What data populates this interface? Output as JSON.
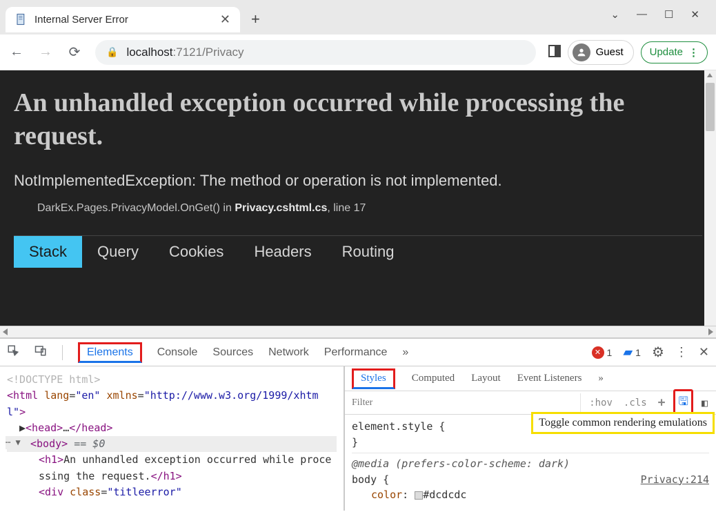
{
  "window": {
    "tab_title": "Internal Server Error"
  },
  "toolbar": {
    "url_host": "localhost",
    "url_port_path": ":7121/Privacy",
    "guest_label": "Guest",
    "update_label": "Update"
  },
  "error_page": {
    "heading": "An unhandled exception occurred while processing the request.",
    "exception_line": "NotImplementedException: The method or operation is not implemented.",
    "stack_prefix": "DarkEx.Pages.PrivacyModel.OnGet() in ",
    "stack_file": "Privacy.cshtml.cs",
    "stack_line_suffix": ", line 17",
    "tabs": [
      "Stack",
      "Query",
      "Cookies",
      "Headers",
      "Routing"
    ]
  },
  "devtools": {
    "tabs": [
      "Elements",
      "Console",
      "Sources",
      "Network",
      "Performance"
    ],
    "more": "»",
    "error_count": "1",
    "info_count": "1",
    "styles_tabs": [
      "Styles",
      "Computed",
      "Layout",
      "Event Listeners"
    ],
    "filter_placeholder": "Filter",
    "hov": ":hov",
    "cls": ".cls",
    "tooltip": "Toggle common rendering emulations",
    "dom": {
      "doctype": "<!DOCTYPE html>",
      "html_open": "<html lang=\"en\" xmlns=\"http://www.w3.org/1999/xhtml\">",
      "head": "<head>…</head>",
      "body_open": "<body>",
      "body_eq": " == $0",
      "h1_text": "An unhandled exception occurred while processing the request.",
      "div_class": "titleerror"
    },
    "rules": {
      "elem_style": "element.style {",
      "media": "@media (prefers-color-scheme: dark)",
      "body_open": "body {",
      "source": "Privacy:214",
      "color_prop": "color",
      "color_val": "#dcdcdc"
    }
  }
}
